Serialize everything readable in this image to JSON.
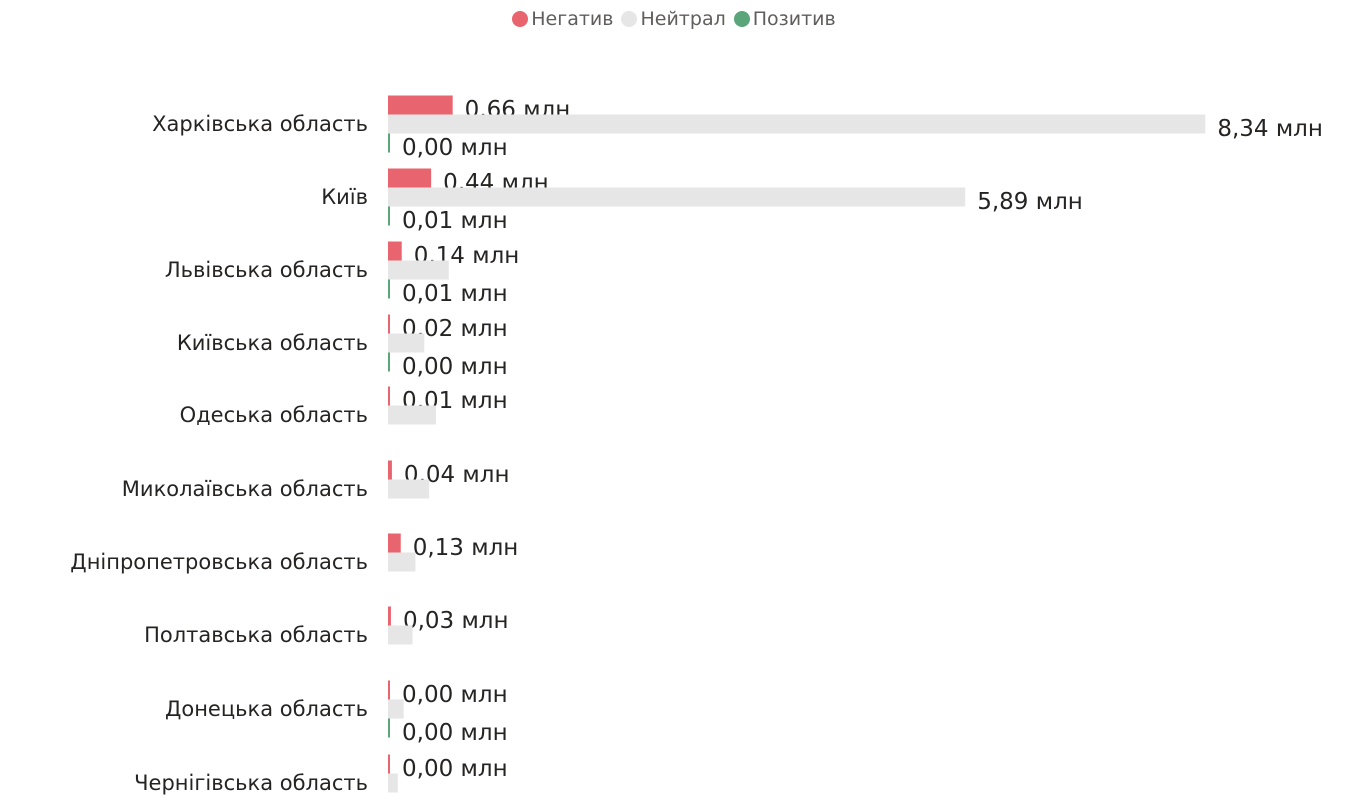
{
  "colors": {
    "negative": "#e8646e",
    "neutral": "#e6e6e6",
    "positive": "#5aa67a"
  },
  "legend": [
    {
      "label": "Негатив",
      "color": "#e8646e"
    },
    {
      "label": "Нейтрал",
      "color": "#e6e6e6"
    },
    {
      "label": "Позитив",
      "color": "#5aa67a"
    }
  ],
  "chart_data": {
    "type": "bar",
    "orientation": "horizontal",
    "grid": false,
    "legend_position": "top-center",
    "categories": [
      "Харківська область",
      "Київ",
      "Львівська область",
      "Київська область",
      "Одеська область",
      "Миколаївська область",
      "Дніпропетровська область",
      "Полтавська область",
      "Донецька область",
      "Чернігівська область"
    ],
    "series": [
      {
        "name": "Негатив",
        "key": "negative",
        "values": [
          0.66,
          0.44,
          0.14,
          0.02,
          0.01,
          0.04,
          0.13,
          0.03,
          0.0,
          0.0
        ],
        "labels": [
          "0,66 млн",
          "0,44 млн",
          "0,14 млн",
          "0,02 млн",
          "0,01 млн",
          "0,04 млн",
          "0,13 млн",
          "0,03 млн",
          "0,00 млн",
          "0,00 млн"
        ]
      },
      {
        "name": "Нейтрал",
        "key": "neutral",
        "values": [
          8.34,
          5.89,
          0.62,
          0.37,
          0.49,
          0.42,
          0.28,
          0.25,
          0.16,
          0.1
        ],
        "labels": [
          "8,34 млн",
          "5,89 млн",
          null,
          null,
          null,
          null,
          null,
          null,
          null,
          null
        ]
      },
      {
        "name": "Позитив",
        "key": "positive",
        "values": [
          0.004,
          0.01,
          0.01,
          0.004,
          null,
          null,
          null,
          null,
          0.004,
          null
        ],
        "labels": [
          "0,00 млн",
          "0,01 млн",
          "0,01 млн",
          "0,00 млн",
          null,
          null,
          null,
          null,
          "0,00 млн",
          null
        ]
      }
    ]
  }
}
